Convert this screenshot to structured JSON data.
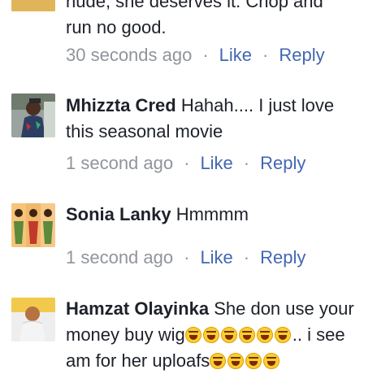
{
  "comments": [
    {
      "author": "",
      "text_lines": [
        "nude, she deserves it. Chop and",
        "run no good."
      ],
      "time": "30 seconds ago",
      "like_label": "Like",
      "reply_label": "Reply"
    },
    {
      "author": "Mhizzta Cred",
      "text_first": "Hahah.... I just love",
      "text_second": "this seasonal movie",
      "time": "1 second ago",
      "like_label": "Like",
      "reply_label": "Reply"
    },
    {
      "author": "Sonia Lanky",
      "text_first": "Hmmmm",
      "time": "1 second ago",
      "like_label": "Like",
      "reply_label": "Reply"
    },
    {
      "author": "Hamzat Olayinka",
      "text_first": "She don use your",
      "text_second": "money buy wig",
      "text_second_after": ".. i see",
      "text_third": "am for her uploafs"
    }
  ],
  "separator": "·",
  "emoji_name": "laughing-with-tears-emoji",
  "colors": {
    "text": "#1d2129",
    "meta_gray": "#90949c",
    "link_blue": "#4267b2",
    "background": "#ffffff"
  }
}
